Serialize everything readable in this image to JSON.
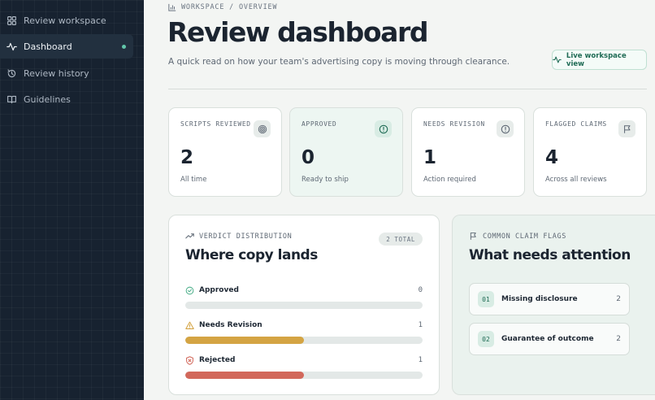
{
  "sidebar": {
    "items": [
      {
        "label": "Review workspace",
        "icon": "grid-icon",
        "active": false
      },
      {
        "label": "Dashboard",
        "icon": "activity-icon",
        "active": true
      },
      {
        "label": "Review history",
        "icon": "history-icon",
        "active": false
      },
      {
        "label": "Guidelines",
        "icon": "book-icon",
        "active": false
      }
    ],
    "active_dot_color": "#62c6aa"
  },
  "header": {
    "breadcrumb": "WORKSPACE / OVERVIEW",
    "title": "Review dashboard",
    "subtitle": "A quick read on how your team's advertising copy is moving through clearance.",
    "live_button": "Live workspace view"
  },
  "stats": [
    {
      "label": "SCRIPTS REVIEWED",
      "value": "2",
      "foot": "All time",
      "icon": "target-icon"
    },
    {
      "label": "APPROVED",
      "value": "0",
      "foot": "Ready to ship",
      "icon": "alert-circle-icon"
    },
    {
      "label": "NEEDS REVISION",
      "value": "1",
      "foot": "Action required",
      "icon": "info-circle-icon"
    },
    {
      "label": "FLAGGED CLAIMS",
      "value": "4",
      "foot": "Across all reviews",
      "icon": "flag-icon"
    }
  ],
  "verdicts": {
    "kicker": "VERDICT DISTRIBUTION",
    "title": "Where copy lands",
    "total_badge": "2 TOTAL",
    "total": 2,
    "rows": [
      {
        "label": "Approved",
        "count": "0",
        "value": 0,
        "color": "#4caf8a",
        "icon": "check-circle-icon"
      },
      {
        "label": "Needs Revision",
        "count": "1",
        "value": 1,
        "color": "#d4a443",
        "icon": "warning-icon"
      },
      {
        "label": "Rejected",
        "count": "1",
        "value": 1,
        "color": "#d2685b",
        "icon": "shield-x-icon"
      }
    ]
  },
  "flags": {
    "kicker": "COMMON CLAIM FLAGS",
    "title": "What needs attention",
    "items": [
      {
        "index": "01",
        "label": "Missing disclosure",
        "count": "2"
      },
      {
        "index": "02",
        "label": "Guarantee of outcome",
        "count": "2"
      }
    ]
  },
  "colors": {
    "sidebar_bg": "#172230",
    "accent": "#1f6b55"
  }
}
